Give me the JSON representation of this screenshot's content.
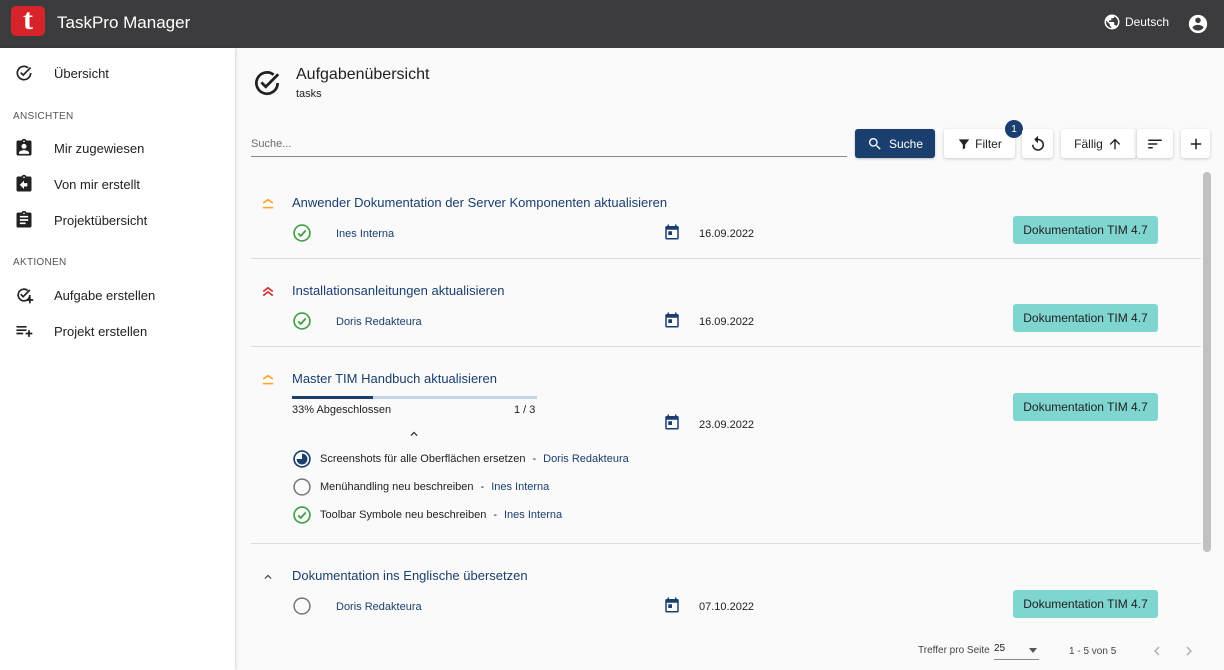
{
  "app": {
    "logo_letter": "t",
    "title": "TaskPro Manager",
    "language": "Deutsch"
  },
  "sidebar": {
    "overview": "Übersicht",
    "section_views": "ANSICHTEN",
    "assigned": "Mir zugewiesen",
    "created_by_me": "Von mir erstellt",
    "project_overview": "Projektübersicht",
    "section_actions": "AKTIONEN",
    "create_task": "Aufgabe erstellen",
    "create_project": "Projekt erstellen"
  },
  "page": {
    "title": "Aufgabenübersicht",
    "subtitle": "tasks"
  },
  "toolbar": {
    "search_placeholder": "Suche...",
    "search_button": "Suche",
    "filter_button": "Filter",
    "filter_count": "1",
    "sort_label": "Fällig"
  },
  "tasks": [
    {
      "title": "Anwender Dokumentation der Server Komponenten aktualisieren",
      "priority": "medium",
      "status": "done",
      "assignee": "Ines Interna",
      "due": "16.09.2022",
      "tag": "Dokumentation TIM 4.7"
    },
    {
      "title": "Installationsanleitungen aktualisieren",
      "priority": "high",
      "status": "done",
      "assignee": "Doris Redakteura",
      "due": "16.09.2022",
      "tag": "Dokumentation TIM 4.7"
    },
    {
      "title": "Master TIM Handbuch aktualisieren",
      "priority": "medium",
      "due": "23.09.2022",
      "tag": "Dokumentation TIM 4.7",
      "progress_label": "33% Abgeschlossen",
      "progress_count": "1 / 3",
      "progress_fraction": 0.33,
      "subtasks": [
        {
          "title": "Screenshots für alle Oberflächen ersetzen",
          "assignee": "Doris Redakteura",
          "status": "in-progress"
        },
        {
          "title": "Menühandling neu beschreiben",
          "assignee": "Ines Interna",
          "status": "open"
        },
        {
          "title": "Toolbar Symbole neu beschreiben",
          "assignee": "Ines Interna",
          "status": "done"
        }
      ]
    },
    {
      "title": "Dokumentation ins Englische übersetzen",
      "priority": "low",
      "status": "open",
      "assignee": "Doris Redakteura",
      "due": "07.10.2022",
      "tag": "Dokumentation TIM 4.7"
    }
  ],
  "pager": {
    "label": "Treffer pro Seite",
    "page_size": "25",
    "range": "1 - 5 von 5"
  },
  "colors": {
    "primary": "#1a3e6e",
    "tag": "#7fd6d0",
    "done": "#43a047",
    "prio_medium": "#f5a623",
    "prio_high": "#d32f2f",
    "logo": "#d7242b"
  }
}
